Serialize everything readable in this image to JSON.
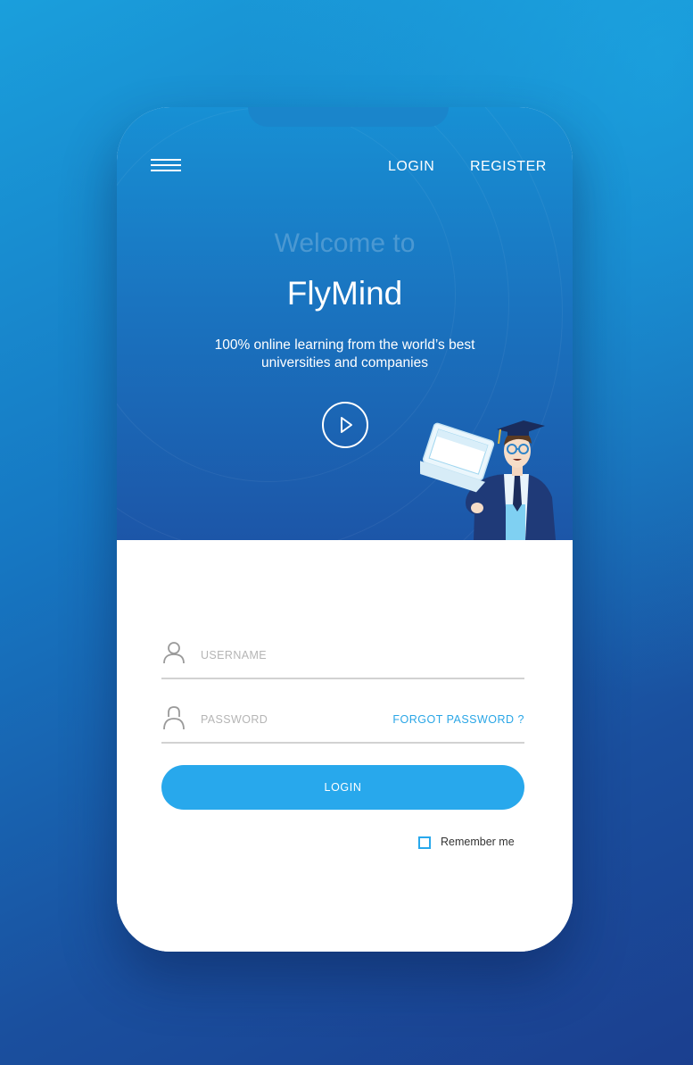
{
  "nav": {
    "login_label": "LOGIN",
    "register_label": "REGISTER"
  },
  "hero": {
    "welcome_text": "Welcome to",
    "brand_name": "FlyMind",
    "tagline": "100% online learning from the world’s best universities and companies"
  },
  "form": {
    "username_placeholder": "USERNAME",
    "password_placeholder": "PASSWORD",
    "forgot_password_label": "FORGOT PASSWORD ?",
    "login_button_label": "LOGIN",
    "remember_me_label": "Remember me",
    "remember_me_checked": false
  },
  "icons": {
    "menu": "hamburger-menu-icon",
    "play": "play-icon",
    "username": "user-icon",
    "password": "lock-icon"
  },
  "colors": {
    "accent": "#28a8ec",
    "hero_top": "#1790d4",
    "hero_bottom": "#1c56a8",
    "background_top": "#1a9fdc",
    "background_bottom": "#1b3f8f"
  }
}
